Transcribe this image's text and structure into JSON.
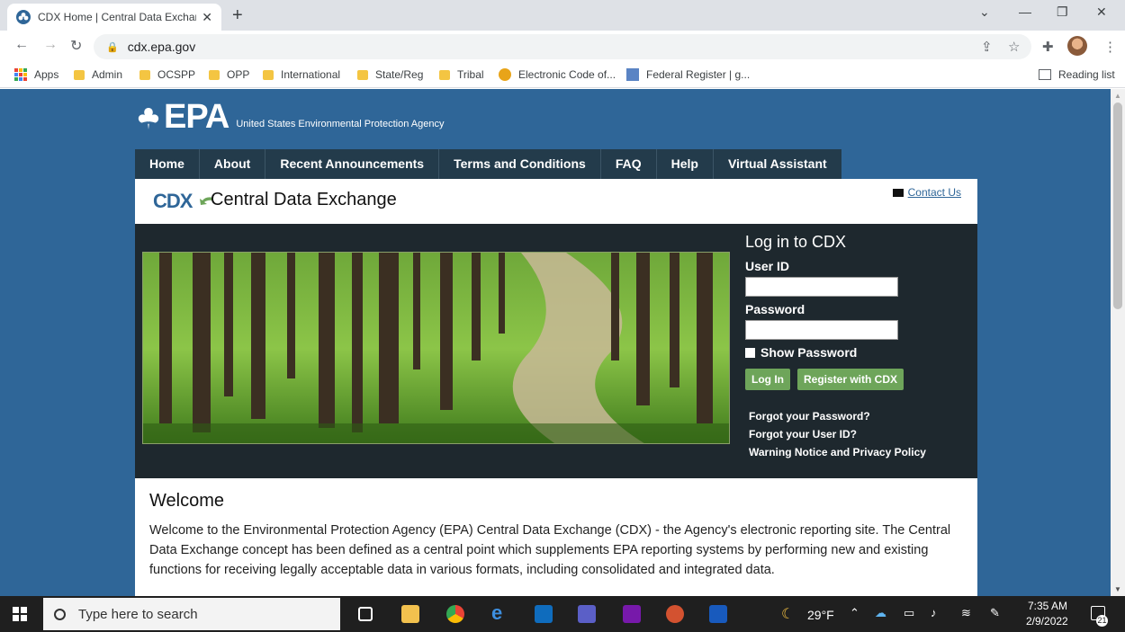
{
  "browser": {
    "tab_title": "CDX Home | Central Data Exchan",
    "url": "cdx.epa.gov",
    "reading_list": "Reading list",
    "bookmarks": [
      "Apps",
      "Admin",
      "OCSPP",
      "OPP",
      "International",
      "State/Reg",
      "Tribal",
      "Electronic Code of...",
      "Federal Register | g..."
    ]
  },
  "page": {
    "logo_letters": "EPA",
    "agency_tagline": "United States Environmental Protection Agency",
    "nav": [
      "Home",
      "About",
      "Recent Announcements",
      "Terms and Conditions",
      "FAQ",
      "Help",
      "Virtual Assistant"
    ],
    "cdx_logo": "CDX",
    "cdx_title": "Central Data Exchange",
    "contact_us": "Contact Us",
    "login": {
      "title": "Log in to CDX",
      "user_id_label": "User ID",
      "password_label": "Password",
      "show_password": "Show Password",
      "login_button": "Log In",
      "register_button": "Register with CDX",
      "forgot_password": "Forgot your Password?",
      "forgot_user_id": "Forgot your User ID?",
      "warning_notice": "Warning Notice and Privacy Policy"
    },
    "welcome_title": "Welcome",
    "welcome_text": "Welcome to the Environmental Protection Agency (EPA) Central Data Exchange (CDX) - the Agency's electronic reporting site. The Central Data Exchange concept has been defined as a central point which supplements EPA reporting systems by performing new and existing functions for receiving legally acceptable data in various formats, including consolidated and integrated data."
  },
  "taskbar": {
    "search_placeholder": "Type here to search",
    "weather": "29°F",
    "time": "7:35 AM",
    "date": "2/9/2022",
    "notifications": "21"
  },
  "colors": {
    "page_blue": "#2f6698",
    "nav_dark": "#233b4b",
    "button_green": "#6ea55a"
  }
}
